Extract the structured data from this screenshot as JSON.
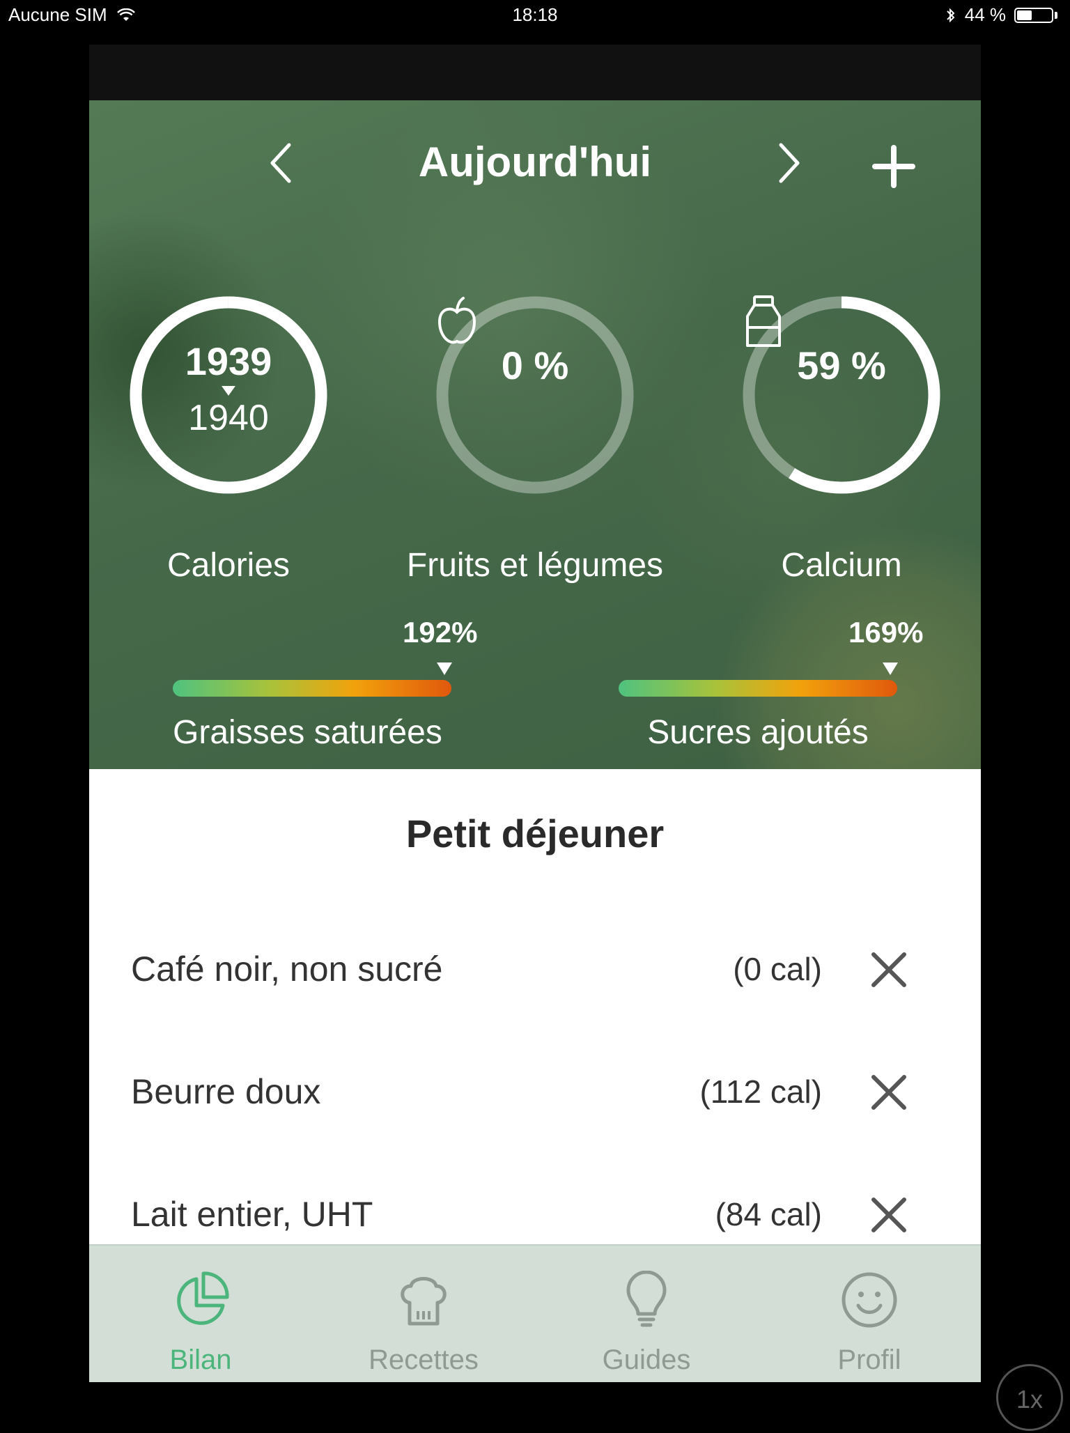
{
  "status_bar": {
    "carrier": "Aucune SIM",
    "time": "18:18",
    "battery": "44 %",
    "battery_level": 0.44
  },
  "header": {
    "title": "Aujourd'hui",
    "icons": {
      "prev": "chevron-left-icon",
      "next": "chevron-right-icon",
      "add": "plus-icon"
    }
  },
  "rings": {
    "calories": {
      "value": "1939",
      "target": "1940",
      "label": "Calories",
      "progress": 0.9995
    },
    "fruits": {
      "value": "0 %",
      "label": "Fruits et légumes",
      "icon": "apple-icon",
      "progress": 0
    },
    "calcium": {
      "value": "59 %",
      "label": "Calcium",
      "icon": "milk-bottle-icon",
      "progress": 0.59
    }
  },
  "bars": {
    "saturated_fat": {
      "percent": "192%",
      "label": "Graisses saturées"
    },
    "added_sugar": {
      "percent": "169%",
      "label": "Sucres ajoutés"
    }
  },
  "meal": {
    "title": "Petit déjeuner",
    "items": [
      {
        "name": "Café noir, non sucré",
        "calories": "(0 cal)"
      },
      {
        "name": "Beurre doux",
        "calories": "(112 cal)"
      },
      {
        "name": "Lait entier, UHT",
        "calories": "(84 cal)"
      }
    ]
  },
  "tabs": [
    {
      "label": "Bilan",
      "icon": "pie-chart-icon",
      "active": true
    },
    {
      "label": "Recettes",
      "icon": "chef-hat-icon",
      "active": false
    },
    {
      "label": "Guides",
      "icon": "lightbulb-icon",
      "active": false
    },
    {
      "label": "Profil",
      "icon": "smiley-icon",
      "active": false
    }
  ],
  "zoom": "1x",
  "colors": {
    "active_tab": "#4bb57c",
    "tab_bar": "#d3ded6",
    "hero_green": "#4a6e4d"
  }
}
